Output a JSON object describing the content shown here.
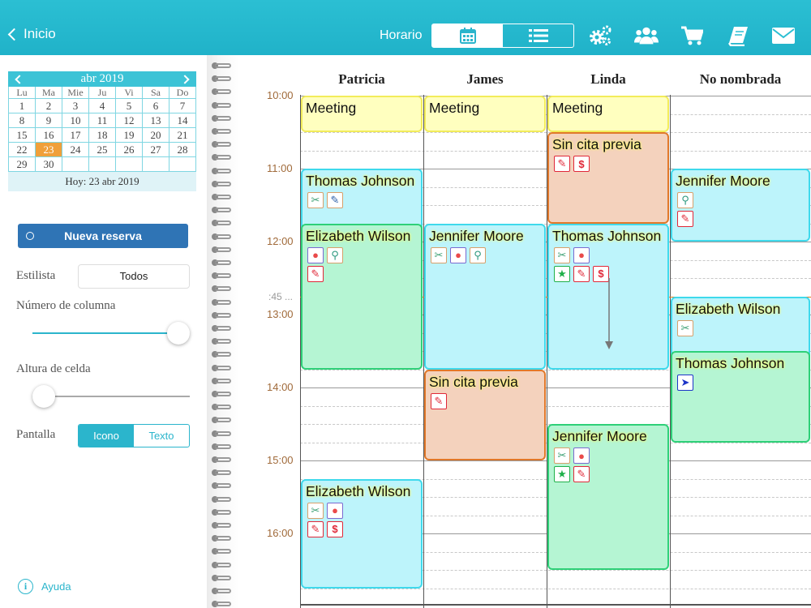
{
  "topbar": {
    "back_label": "Inicio",
    "view_label": "Horario",
    "view_modes": [
      "calendar-icon",
      "list-icon"
    ],
    "active_view": "calendar",
    "icons": [
      "gears-icon",
      "users-icon",
      "cart-icon",
      "book-icon",
      "mail-icon"
    ],
    "accent_color": "#22b6cc"
  },
  "calendar": {
    "month_label": "abr 2019",
    "weekdays": [
      "Lu",
      "Ma",
      "Mie",
      "Ju",
      "Vi",
      "Sa",
      "Do"
    ],
    "weeks": [
      [
        "1",
        "2",
        "3",
        "4",
        "5",
        "6",
        "7"
      ],
      [
        "8",
        "9",
        "10",
        "11",
        "12",
        "13",
        "14"
      ],
      [
        "15",
        "16",
        "17",
        "18",
        "19",
        "20",
        "21"
      ],
      [
        "22",
        "23",
        "24",
        "25",
        "26",
        "27",
        "28"
      ],
      [
        "29",
        "30",
        "",
        "",
        "",
        "",
        ""
      ]
    ],
    "selected_day": "23",
    "today_label": "Hoy: 23 abr 2019"
  },
  "sidebar": {
    "new_booking_label": "Nueva reserva",
    "stylist_label": "Estilista",
    "stylist_value": "Todos",
    "columns_label": "Número de columna",
    "columns_slider_value": 1.0,
    "cell_height_label": "Altura de celda",
    "cell_height_slider_value": 0.0,
    "display_label": "Pantalla",
    "display_options": [
      "Icono",
      "Texto"
    ],
    "display_selected": "Icono",
    "help_label": "Ayuda"
  },
  "schedule": {
    "columns": [
      "Patricia",
      "James",
      "Linda",
      "No nombrada"
    ],
    "times": [
      "10:00",
      "11:00",
      "12:00",
      "13:00",
      "14:00",
      "15:00",
      "16:00"
    ],
    "current_time_label": ":45",
    "appointments": [
      {
        "col": 0,
        "start": "10:00",
        "end": "10:30",
        "title": "Meeting",
        "kind": "meeting",
        "icons": []
      },
      {
        "col": 1,
        "start": "10:00",
        "end": "10:30",
        "title": "Meeting",
        "kind": "meeting",
        "icons": []
      },
      {
        "col": 2,
        "start": "10:00",
        "end": "10:30",
        "title": "Meeting",
        "kind": "meeting",
        "icons": []
      },
      {
        "col": 2,
        "start": "10:30",
        "end": "11:45",
        "title": "Sin cita previa",
        "kind": "orange",
        "icons": [
          [
            "edit-icon",
            "dollar-icon"
          ]
        ]
      },
      {
        "col": 0,
        "start": "11:00",
        "end": "12:00",
        "title": "Thomas Johnson",
        "kind": "cyan",
        "icons": [
          [
            "scissors-icon",
            "brush-icon"
          ]
        ]
      },
      {
        "col": 3,
        "start": "11:00",
        "end": "12:00",
        "title": "Jennifer Moore",
        "kind": "cyan",
        "icons": [
          [
            "dryer-icon"
          ],
          [
            "edit-icon"
          ]
        ]
      },
      {
        "col": 0,
        "start": "11:45",
        "end": "13:45",
        "title": "Elizabeth Wilson",
        "kind": "green",
        "icons": [
          [
            "drop-icon",
            "dryer-icon"
          ],
          [
            "edit-icon"
          ]
        ]
      },
      {
        "col": 1,
        "start": "11:45",
        "end": "13:45",
        "title": "Jennifer Moore",
        "kind": "cyan",
        "icons": [
          [
            "scissors-icon",
            "drop-icon",
            "dryer-icon"
          ]
        ]
      },
      {
        "col": 2,
        "start": "11:45",
        "end": "13:45",
        "title": "Thomas Johnson",
        "kind": "cyan",
        "icons": [
          [
            "scissors-icon",
            "drop-icon"
          ],
          [
            "star-icon",
            "edit-icon",
            "dollar-icon"
          ]
        ]
      },
      {
        "col": 3,
        "start": "12:45",
        "end": "13:45",
        "title": "Elizabeth Wilson",
        "kind": "cyan",
        "icons": [
          [
            "scissors-icon"
          ]
        ]
      },
      {
        "col": 3,
        "start": "13:30",
        "end": "14:45",
        "title": "Thomas Johnson",
        "kind": "green",
        "icons": [
          [
            "send-icon"
          ]
        ]
      },
      {
        "col": 1,
        "start": "13:45",
        "end": "15:00",
        "title": "Sin cita previa",
        "kind": "orange",
        "icons": [
          [
            "edit-icon"
          ]
        ]
      },
      {
        "col": 2,
        "start": "14:30",
        "end": "16:30",
        "title": "Jennifer Moore",
        "kind": "green",
        "icons": [
          [
            "scissors-icon",
            "drop-icon"
          ],
          [
            "star-icon",
            "edit-icon"
          ]
        ]
      },
      {
        "col": 0,
        "start": "15:15",
        "end": "16:45",
        "title": "Elizabeth Wilson",
        "kind": "cyan",
        "icons": [
          [
            "scissors-icon",
            "drop-icon"
          ],
          [
            "edit-icon",
            "dollar-icon"
          ]
        ]
      }
    ]
  }
}
